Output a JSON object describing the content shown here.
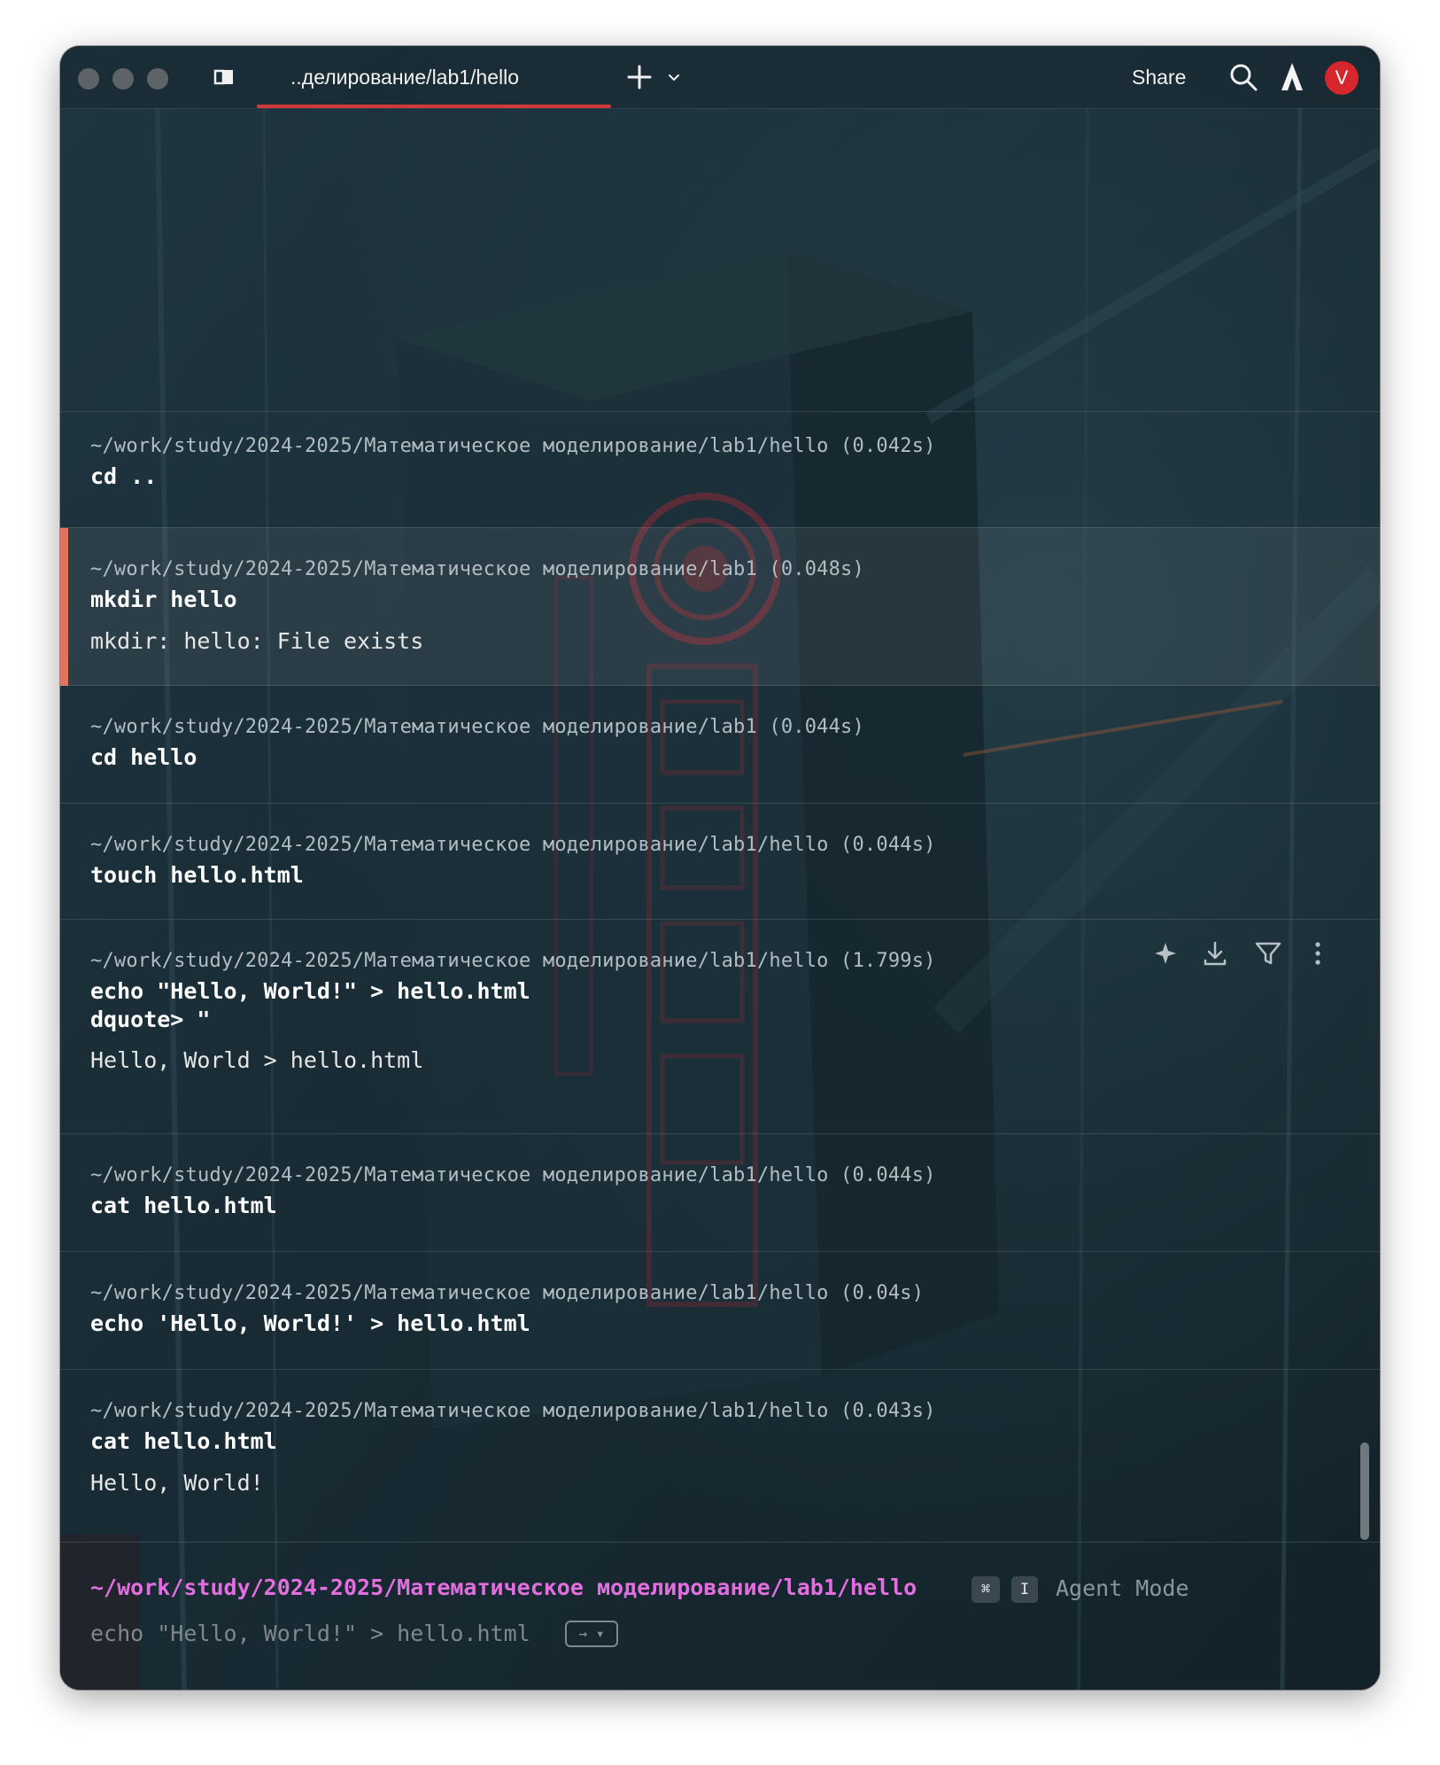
{
  "window": {
    "tab_title": "..делирование/lab1/hello",
    "share_label": "Share",
    "avatar_letter": "V",
    "accent_color": "#d23a3a",
    "icons": [
      "sidebar-icon",
      "plus-icon",
      "chevron-down-icon",
      "search-icon",
      "warp-icon"
    ]
  },
  "blocks": [
    {
      "path": "~/work/study/2024-2025/Математическое моделирование/lab1/hello (0.042s)",
      "command": "cd ..",
      "output": ""
    },
    {
      "path": "~/work/study/2024-2025/Математическое моделирование/lab1 (0.048s)",
      "command": "mkdir hello",
      "output": "mkdir: hello: File exists",
      "status": "error"
    },
    {
      "path": "~/work/study/2024-2025/Математическое моделирование/lab1 (0.044s)",
      "command": "cd hello",
      "output": ""
    },
    {
      "path": "~/work/study/2024-2025/Математическое моделирование/lab1/hello (0.044s)",
      "command": "touch hello.html",
      "output": ""
    },
    {
      "path": "~/work/study/2024-2025/Математическое моделирование/lab1/hello (1.799s)",
      "command": "echo \"Hello, World!\" > hello.html",
      "command_continuation": "dquote> \"",
      "output": "Hello, World > hello.html",
      "actions": [
        "sparkle-icon",
        "download-icon",
        "filter-icon",
        "more-icon"
      ]
    },
    {
      "path": "~/work/study/2024-2025/Математическое моделирование/lab1/hello (0.044s)",
      "command": "cat hello.html",
      "output": ""
    },
    {
      "path": "~/work/study/2024-2025/Математическое моделирование/lab1/hello (0.04s)",
      "command": "echo 'Hello, World!' > hello.html",
      "output": ""
    },
    {
      "path": "~/work/study/2024-2025/Математическое моделирование/lab1/hello (0.043s)",
      "command": "cat hello.html",
      "output": "Hello, World!"
    }
  ],
  "prompt": {
    "path": "~/work/study/2024-2025/Математическое моделирование/lab1/hello",
    "shortcut_key1": "⌘",
    "shortcut_key2": "I",
    "agent_mode_label": "Agent Mode",
    "autosuggestion": "echo \"Hello, World!\" > hello.html",
    "accept_hint": "→ ▾",
    "path_color": "#e26ee0"
  }
}
